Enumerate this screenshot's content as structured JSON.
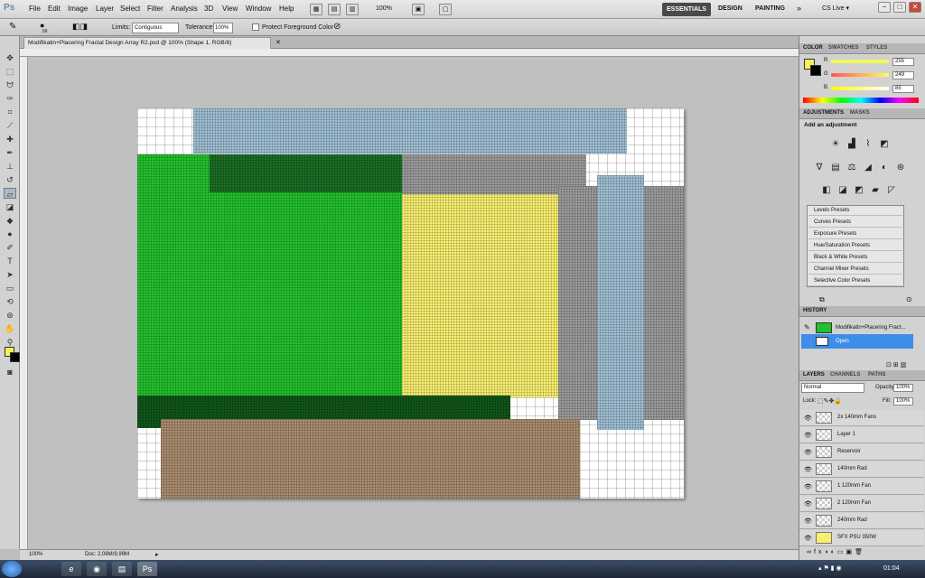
{
  "app": {
    "logo": "Ps"
  },
  "menu": [
    "File",
    "Edit",
    "Image",
    "Layer",
    "Select",
    "Filter",
    "Analysis",
    "3D",
    "View",
    "Window",
    "Help"
  ],
  "menubar_icons": {
    "zoom": "100%"
  },
  "workspace": {
    "essentials": "ESSENTIALS",
    "design": "DESIGN",
    "painting": "PAINTING",
    "more": "»",
    "cslive": "CS Live ▾"
  },
  "window_buttons": {
    "minimize": "−",
    "maximize": "□",
    "close": "✕"
  },
  "options": {
    "brush_size": "56",
    "limits_label": "Limits:",
    "limits_value": "Contiguous",
    "tolerance_label": "Tolerance:",
    "tolerance_value": "100%",
    "protect_label": "Protect Foreground Color"
  },
  "document": {
    "tab_title": "Modifikatin+Placering  Fractal Design  Array R2.psd @ 100% (Shape 1, RGB/8)",
    "close": "✕"
  },
  "status": {
    "zoom": "100%",
    "doc": "Doc: 2,08M/9,99M"
  },
  "colors": {
    "canvas_bg": "#ffffff",
    "grid": "#9a9a9a",
    "blue": "#9fbfd3",
    "green": "#22c12b",
    "dark_green": "#11561a",
    "yellow": "#f8ef70",
    "gray": "#9b9b9b",
    "brown": "#a98c6e",
    "foreground": "#f3f05c",
    "background": "#000000"
  },
  "color_panel": {
    "tabs": [
      "COLOR",
      "SWATCHES",
      "STYLES"
    ],
    "r_label": "R",
    "g_label": "G",
    "b_label": "B",
    "r": "255",
    "g": "249",
    "b": "85"
  },
  "adjustments": {
    "tabs": [
      "ADJUSTMENTS",
      "MASKS"
    ],
    "title": "Add an adjustment",
    "presets": [
      "Levels Presets",
      "Curves Presets",
      "Exposure Presets",
      "Hue/Saturation Presets",
      "Black & White Presets",
      "Channel Mixer Presets",
      "Selective Color Presets"
    ]
  },
  "history": {
    "tab": "HISTORY",
    "snapshot": "Modifikatin+Placering  Fract...",
    "items": [
      "Open"
    ]
  },
  "layers": {
    "tabs": [
      "LAYERS",
      "CHANNELS",
      "PATHS"
    ],
    "blend_mode": "Normal",
    "opacity_label": "Opacity:",
    "opacity": "100%",
    "lock_label": "Lock:",
    "fill_label": "Fill:",
    "fill": "100%",
    "items": [
      "2x 140mm Fans",
      "Layer 1",
      "Reservoir",
      "140mm Rad",
      "1 120mm Fan",
      "2 120mm Fan",
      "240mm Rad",
      "SFX PSU 350W"
    ]
  },
  "taskbar": {
    "time": "01:04"
  }
}
